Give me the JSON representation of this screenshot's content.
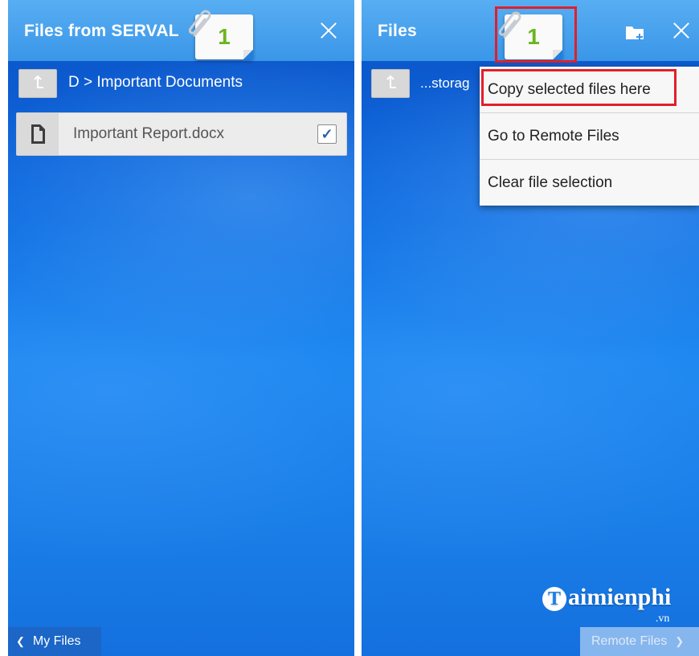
{
  "left_panel": {
    "title": "Files from SERVAL",
    "badge_count": "1",
    "path": "D > Important Documents",
    "files": [
      {
        "name": "Important Report.docx",
        "checked": true,
        "check_mark": "✓"
      }
    ],
    "bottom_button": "My Files",
    "bottom_chevron": "❮"
  },
  "right_panel": {
    "title": "Files",
    "badge_count": "1",
    "path": "...storag",
    "menu": [
      {
        "label": "Copy selected files here",
        "highlighted": true
      },
      {
        "label": "Go to Remote Files",
        "highlighted": false
      },
      {
        "label": "Clear file selection",
        "highlighted": false
      }
    ],
    "bottom_button": "Remote Files",
    "bottom_chevron": "❯",
    "watermark": {
      "brand": "aimienphi",
      "brand_initial": "T",
      "suffix": ".vn"
    }
  },
  "colors": {
    "topbar": "#3a96e8",
    "background": "#1a86f0",
    "badge_text": "#6cb61e",
    "highlight": "#e0202a"
  },
  "icons": [
    "paperclip-icon",
    "close-icon",
    "up-arrow-icon",
    "document-icon",
    "checkbox-icon",
    "new-folder-icon",
    "chevron-left-icon",
    "chevron-right-icon"
  ]
}
